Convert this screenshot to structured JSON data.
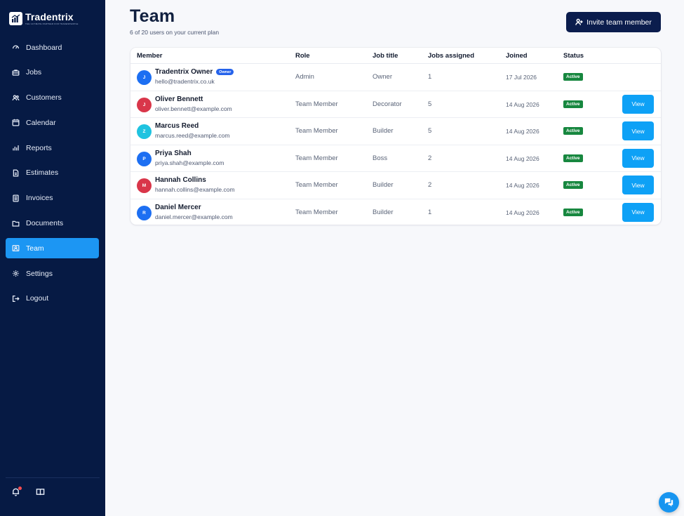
{
  "brand": {
    "name": "Tradentrix",
    "tagline": "THE ULTIMATE PARTNER FOR TRADESPEOPLE"
  },
  "sidebar": {
    "items": [
      {
        "label": "Dashboard",
        "icon": "gauge-icon",
        "active": false
      },
      {
        "label": "Jobs",
        "icon": "briefcase-icon",
        "active": false
      },
      {
        "label": "Customers",
        "icon": "users-icon",
        "active": false
      },
      {
        "label": "Calendar",
        "icon": "calendar-icon",
        "active": false
      },
      {
        "label": "Reports",
        "icon": "bar-chart-icon",
        "active": false
      },
      {
        "label": "Estimates",
        "icon": "file-icon",
        "active": false
      },
      {
        "label": "Invoices",
        "icon": "receipt-icon",
        "active": false
      },
      {
        "label": "Documents",
        "icon": "folder-icon",
        "active": false
      },
      {
        "label": "Team",
        "icon": "team-icon",
        "active": true
      },
      {
        "label": "Settings",
        "icon": "gear-icon",
        "active": false
      },
      {
        "label": "Logout",
        "icon": "logout-icon",
        "active": false
      }
    ],
    "bottom_icons": [
      "bell-icon",
      "book-icon"
    ]
  },
  "header": {
    "title": "Team",
    "subtitle": "6 of 20 users on your current plan",
    "invite_label": "Invite team member"
  },
  "table": {
    "columns": [
      "Member",
      "Role",
      "Job title",
      "Jobs assigned",
      "Joined",
      "Status"
    ],
    "owner_badge": "Owner",
    "view_label": "View",
    "rows": [
      {
        "initial": "J",
        "name": "Tradentrix Owner",
        "email": "hello@tradentrix.co.uk",
        "role": "Admin",
        "job_title": "Owner",
        "jobs": "1",
        "joined": "17 Jul 2026",
        "status": "Active",
        "owner": true,
        "avatar_color": "#1d6ff2"
      },
      {
        "initial": "J",
        "name": "Oliver Bennett",
        "email": "oliver.bennett@example.com",
        "role": "Team Member",
        "job_title": "Decorator",
        "jobs": "5",
        "joined": "14 Aug 2026",
        "status": "Active",
        "owner": false,
        "avatar_color": "#d9364a"
      },
      {
        "initial": "Z",
        "name": "Marcus Reed",
        "email": "marcus.reed@example.com",
        "role": "Team Member",
        "job_title": "Builder",
        "jobs": "5",
        "joined": "14 Aug 2026",
        "status": "Active",
        "owner": false,
        "avatar_color": "#1fc3e0"
      },
      {
        "initial": "P",
        "name": "Priya Shah",
        "email": "priya.shah@example.com",
        "role": "Team Member",
        "job_title": "Boss",
        "jobs": "2",
        "joined": "14 Aug 2026",
        "status": "Active",
        "owner": false,
        "avatar_color": "#1d6ff2"
      },
      {
        "initial": "M",
        "name": "Hannah Collins",
        "email": "hannah.collins@example.com",
        "role": "Team Member",
        "job_title": "Builder",
        "jobs": "2",
        "joined": "14 Aug 2026",
        "status": "Active",
        "owner": false,
        "avatar_color": "#d9364a"
      },
      {
        "initial": "R",
        "name": "Daniel Mercer",
        "email": "daniel.mercer@example.com",
        "role": "Team Member",
        "job_title": "Builder",
        "jobs": "1",
        "joined": "14 Aug 2026",
        "status": "Active",
        "owner": false,
        "avatar_color": "#1d6ff2"
      }
    ]
  },
  "colors": {
    "sidebar_bg": "#061a44",
    "accent": "#1c96f3",
    "status_active": "#17873f",
    "invite_bg": "#0b1d4d"
  },
  "chat_icon": "chat-icon"
}
